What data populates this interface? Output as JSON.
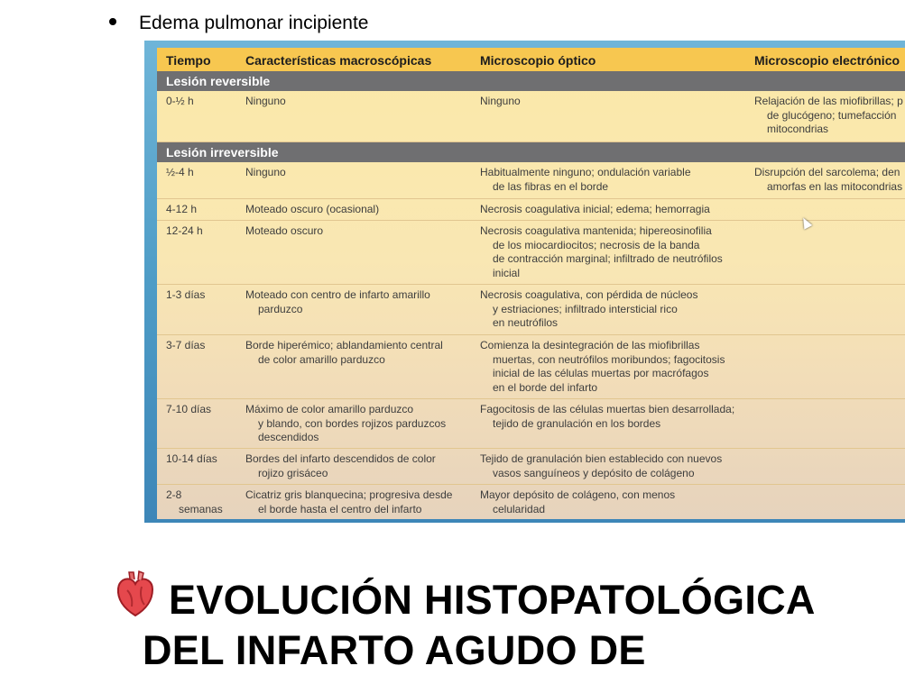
{
  "bullet": {
    "text": "Edema pulmonar incipiente"
  },
  "table": {
    "headers": [
      "Tiempo",
      "Características macroscópicas",
      "Microscopio óptico",
      "Microscopio electrónico"
    ],
    "sections": [
      {
        "label": "Lesión reversible"
      },
      {
        "label": "Lesión irreversible"
      }
    ],
    "rows": [
      {
        "c1": [
          "0-½ h"
        ],
        "c2": [
          "Ninguno"
        ],
        "c3": [
          "Ninguno"
        ],
        "c4": [
          "Relajación de las miofibrillas; p",
          "de glucógeno; tumefacción",
          "mitocondrias"
        ]
      },
      {
        "c1": [
          "½-4 h"
        ],
        "c2": [
          "Ninguno"
        ],
        "c3": [
          "Habitualmente ninguno; ondulación variable",
          "de las fibras en el borde"
        ],
        "c4": [
          "Disrupción del sarcolema; den",
          "amorfas en las mitocondrias"
        ]
      },
      {
        "c1": [
          "4-12 h"
        ],
        "c2": [
          "Moteado oscuro (ocasional)"
        ],
        "c3": [
          "Necrosis coagulativa inicial; edema; hemorragia"
        ],
        "c4": []
      },
      {
        "c1": [
          "12-24 h"
        ],
        "c2": [
          "Moteado oscuro"
        ],
        "c3": [
          "Necrosis coagulativa mantenida; hipereosinofilia",
          "de los miocardiocitos; necrosis de la banda",
          "de contracción marginal; infiltrado de neutrófilos",
          "inicial"
        ],
        "c4": []
      },
      {
        "c1": [
          "1-3 días"
        ],
        "c2": [
          "Moteado con centro de infarto amarillo",
          "parduzco"
        ],
        "c3": [
          "Necrosis coagulativa, con pérdida de núcleos",
          "y estriaciones; infiltrado intersticial rico",
          "en neutrófilos"
        ],
        "c4": []
      },
      {
        "c1": [
          "3-7 días"
        ],
        "c2": [
          "Borde hiperémico; ablandamiento central",
          "de color amarillo parduzco"
        ],
        "c3": [
          "Comienza la desintegración de las miofibrillas",
          "muertas, con neutrófilos moribundos; fagocitosis",
          "inicial de las células muertas por macrófagos",
          "en el borde del infarto"
        ],
        "c4": []
      },
      {
        "c1": [
          "7-10 días"
        ],
        "c2": [
          "Máximo de color amarillo parduzco",
          "y blando, con bordes rojizos parduzcos",
          "descendidos"
        ],
        "c3": [
          "Fagocitosis de las células muertas bien desarrollada;",
          "tejido de granulación en los bordes"
        ],
        "c4": []
      },
      {
        "c1": [
          "10-14 días"
        ],
        "c2": [
          "Bordes del infarto descendidos de color",
          "rojizo grisáceo"
        ],
        "c3": [
          "Tejido de granulación bien establecido con nuevos",
          "vasos sanguíneos y depósito de colágeno"
        ],
        "c4": []
      },
      {
        "c1": [
          "2-8",
          "semanas"
        ],
        "c2": [
          "Cicatriz gris blanquecina; progresiva desde",
          "el borde hasta el centro del infarto"
        ],
        "c3": [
          "Mayor depósito de colágeno, con menos",
          "celularidad"
        ],
        "c4": []
      }
    ]
  },
  "heading": {
    "icon": "anatomical-heart-icon",
    "line1": "EVOLUCIÓN HISTOPATOLÓGICA",
    "line2": "DEL INFARTO AGUDO DE"
  }
}
